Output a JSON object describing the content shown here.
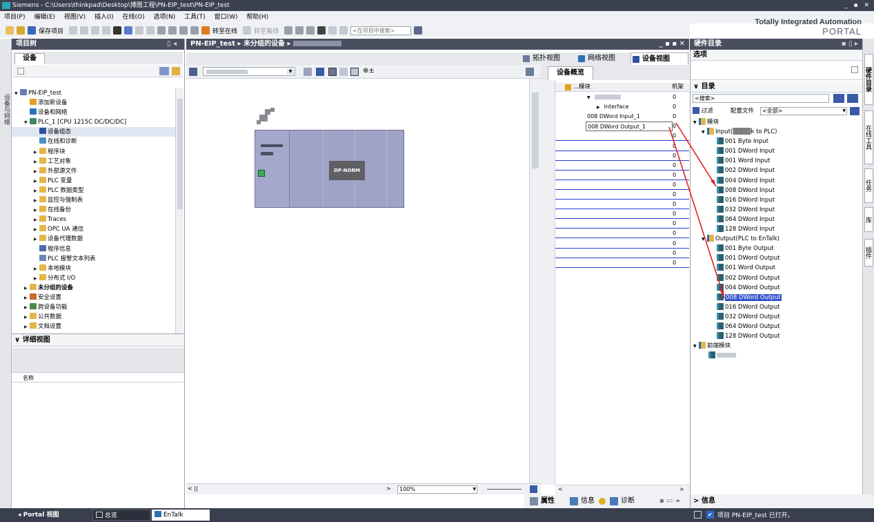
{
  "window": {
    "title": "Siemens  -  C:\\Users\\thinkpad\\Desktop\\博图工程\\PN-EIP_test\\PN-EIP_test",
    "controls": "_ ▪ ✕"
  },
  "menu": [
    "项目(P)",
    "编辑(E)",
    "视图(V)",
    "插入(I)",
    "在线(O)",
    "选项(N)",
    "工具(T)",
    "窗口(W)",
    "帮助(H)"
  ],
  "brand": {
    "line1": "Totally Integrated Automation",
    "line2": "PORTAL"
  },
  "toolbar": {
    "save": "保存项目",
    "go_online": "转至在线",
    "go_offline": "转至离线",
    "search_placeholder": "<在项目中搜索>"
  },
  "left_tab": "设备与网络",
  "project_tree": {
    "header": "项目树",
    "tab": "设备",
    "items": [
      {
        "label": "PN-EIP_test",
        "depth": 0,
        "arrow": "▼",
        "icon": "project-icon",
        "color": "#6a7ab8"
      },
      {
        "label": "添加新设备",
        "depth": 1,
        "arrow": "",
        "icon": "add-device-icon",
        "color": "#e0a020"
      },
      {
        "label": "设备和网络",
        "depth": 1,
        "arrow": "",
        "icon": "network-icon",
        "color": "#2a70b8"
      },
      {
        "label": "PLC_1 [CPU 1215C DC/DC/DC]",
        "depth": 1,
        "arrow": "▼",
        "icon": "plc-icon",
        "color": "#3a8a60"
      },
      {
        "label": "设备组态",
        "depth": 2,
        "arrow": "",
        "icon": "device-config-icon",
        "color": "#2f4fa0",
        "selected": true
      },
      {
        "label": "在线和诊断",
        "depth": 2,
        "arrow": "",
        "icon": "diagnostics-icon",
        "color": "#4a90c8"
      },
      {
        "label": "程序块",
        "depth": 2,
        "arrow": "▶",
        "icon": "folder-icon",
        "color": "#e4b648"
      },
      {
        "label": "工艺对象",
        "depth": 2,
        "arrow": "▶",
        "icon": "folder-icon",
        "color": "#e4b648"
      },
      {
        "label": "外部源文件",
        "depth": 2,
        "arrow": "▶",
        "icon": "folder-icon",
        "color": "#e4b648"
      },
      {
        "label": "PLC 变量",
        "depth": 2,
        "arrow": "▶",
        "icon": "folder-icon",
        "color": "#e4b648"
      },
      {
        "label": "PLC 数据类型",
        "depth": 2,
        "arrow": "▶",
        "icon": "folder-icon",
        "color": "#e4b648"
      },
      {
        "label": "监控与强制表",
        "depth": 2,
        "arrow": "▶",
        "icon": "folder-icon",
        "color": "#e4b648"
      },
      {
        "label": "在线备份",
        "depth": 2,
        "arrow": "▶",
        "icon": "folder-icon",
        "color": "#e4b648"
      },
      {
        "label": "Traces",
        "depth": 2,
        "arrow": "▶",
        "icon": "folder-icon",
        "color": "#e4b648"
      },
      {
        "label": "OPC UA 通信",
        "depth": 2,
        "arrow": "▶",
        "icon": "folder-icon",
        "color": "#e4b648"
      },
      {
        "label": "设备代理数据",
        "depth": 2,
        "arrow": "▶",
        "icon": "folder-icon",
        "color": "#e4b648"
      },
      {
        "label": "程序信息",
        "depth": 2,
        "arrow": "",
        "icon": "info-icon",
        "color": "#4a6aa8"
      },
      {
        "label": "PLC 报警文本列表",
        "depth": 2,
        "arrow": "",
        "icon": "list-icon",
        "color": "#6a88b8"
      },
      {
        "label": "本地模块",
        "depth": 2,
        "arrow": "▶",
        "icon": "folder-icon",
        "color": "#e4b648"
      },
      {
        "label": "分布式 I/O",
        "depth": 2,
        "arrow": "▶",
        "icon": "folder-icon",
        "color": "#e4b648"
      },
      {
        "label": "未分组的设备",
        "depth": 1,
        "arrow": "▶",
        "icon": "folder-icon",
        "color": "#e4b648",
        "bold": true
      },
      {
        "label": "安全设置",
        "depth": 1,
        "arrow": "▶",
        "icon": "security-icon",
        "color": "#c86a2a"
      },
      {
        "label": "跨设备功能",
        "depth": 1,
        "arrow": "▶",
        "icon": "cross-device-icon",
        "color": "#4a8a4a"
      },
      {
        "label": "公共数据",
        "depth": 1,
        "arrow": "▶",
        "icon": "folder-icon",
        "color": "#e4b648"
      },
      {
        "label": "文档设置",
        "depth": 1,
        "arrow": "▶",
        "icon": "folder-icon",
        "color": "#e4b648"
      }
    ]
  },
  "detail_view": {
    "header": "详细视图",
    "column": "名称"
  },
  "editor": {
    "breadcrumb": [
      "PN-EIP_test",
      "未分组的设备"
    ],
    "views": [
      "拓扑视图",
      "网络视图",
      "设备视图"
    ],
    "module_label": "DP-NORM",
    "zoom": "100%"
  },
  "overview": {
    "tab": "设备概览",
    "col_module": "模块",
    "col_rack": "机架",
    "rows": [
      {
        "module": "",
        "rack": "0",
        "arrow": "▼"
      },
      {
        "module": "Interface",
        "rack": "0",
        "arrow": "▶"
      },
      {
        "module": "008 DWord Input_1",
        "rack": "0"
      },
      {
        "module": "008 DWord Output_1",
        "rack": "0",
        "selected": true
      },
      {
        "module": "",
        "rack": "0"
      },
      {
        "module": "",
        "rack": "0"
      },
      {
        "module": "",
        "rack": "0"
      },
      {
        "module": "",
        "rack": "0"
      },
      {
        "module": "",
        "rack": "0"
      },
      {
        "module": "",
        "rack": "0"
      },
      {
        "module": "",
        "rack": "0"
      },
      {
        "module": "",
        "rack": "0"
      },
      {
        "module": "",
        "rack": "0"
      },
      {
        "module": "",
        "rack": "0"
      },
      {
        "module": "",
        "rack": "0"
      },
      {
        "module": "",
        "rack": "0"
      },
      {
        "module": "",
        "rack": "0"
      },
      {
        "module": "",
        "rack": "0"
      }
    ]
  },
  "catalog": {
    "header": "硬件目录",
    "options": "选项",
    "section": "目录",
    "search": "<搜索>",
    "filter": "过滤",
    "profile_label": "配置文件",
    "profile_value": "<全部>",
    "tree": [
      {
        "label": "模块",
        "depth": 0,
        "arrow": "▼",
        "type": "folder"
      },
      {
        "label": "Input(▒▒▒▒k to PLC)",
        "depth": 1,
        "arrow": "▼",
        "type": "folder"
      },
      {
        "label": "001 Byte Input",
        "depth": 2,
        "type": "module"
      },
      {
        "label": "001 DWord Input",
        "depth": 2,
        "type": "module"
      },
      {
        "label": "001 Word Input",
        "depth": 2,
        "type": "module"
      },
      {
        "label": "002 DWord Input",
        "depth": 2,
        "type": "module"
      },
      {
        "label": "004 DWord Input",
        "depth": 2,
        "type": "module"
      },
      {
        "label": "008 DWord Input",
        "depth": 2,
        "type": "module"
      },
      {
        "label": "016 DWord Input",
        "depth": 2,
        "type": "module"
      },
      {
        "label": "032 DWord Input",
        "depth": 2,
        "type": "module"
      },
      {
        "label": "064 DWord Input",
        "depth": 2,
        "type": "module"
      },
      {
        "label": "128 DWord Input",
        "depth": 2,
        "type": "module"
      },
      {
        "label": "Output(PLC to EnTalk)",
        "depth": 1,
        "arrow": "▼",
        "type": "folder"
      },
      {
        "label": "001 Byte Output",
        "depth": 2,
        "type": "module"
      },
      {
        "label": "001 DWord Output",
        "depth": 2,
        "type": "module"
      },
      {
        "label": "001 Word Output",
        "depth": 2,
        "type": "module"
      },
      {
        "label": "002 DWord Output",
        "depth": 2,
        "type": "module"
      },
      {
        "label": "004 DWord Output",
        "depth": 2,
        "type": "module"
      },
      {
        "label": "008 DWord Output",
        "depth": 2,
        "type": "module",
        "highlight": true
      },
      {
        "label": "016 DWord Output",
        "depth": 2,
        "type": "module"
      },
      {
        "label": "032 DWord Output",
        "depth": 2,
        "type": "module"
      },
      {
        "label": "064 DWord Output",
        "depth": 2,
        "type": "module"
      },
      {
        "label": "128 DWord Output",
        "depth": 2,
        "type": "module"
      },
      {
        "label": "前端模块",
        "depth": 0,
        "arrow": "▼",
        "type": "folder"
      },
      {
        "label": "",
        "depth": 1,
        "type": "module"
      }
    ]
  },
  "right_tabs": [
    "硬件目录",
    "在线工具",
    "任务",
    "库",
    "插件"
  ],
  "bottom": {
    "properties": "属性",
    "info": "信息",
    "diagnostics": "诊断",
    "info_panel": "信息"
  },
  "status": {
    "portal_view": "Portal 视图",
    "overview": "总览",
    "entalk": "EnTalk",
    "message": "项目 PN-EIP_test 已打开。"
  },
  "colors": {
    "dark_header": "#4a4f60",
    "device_body": "#9ea3c7",
    "highlight": "#3355cc",
    "arrow": "#e02020"
  }
}
